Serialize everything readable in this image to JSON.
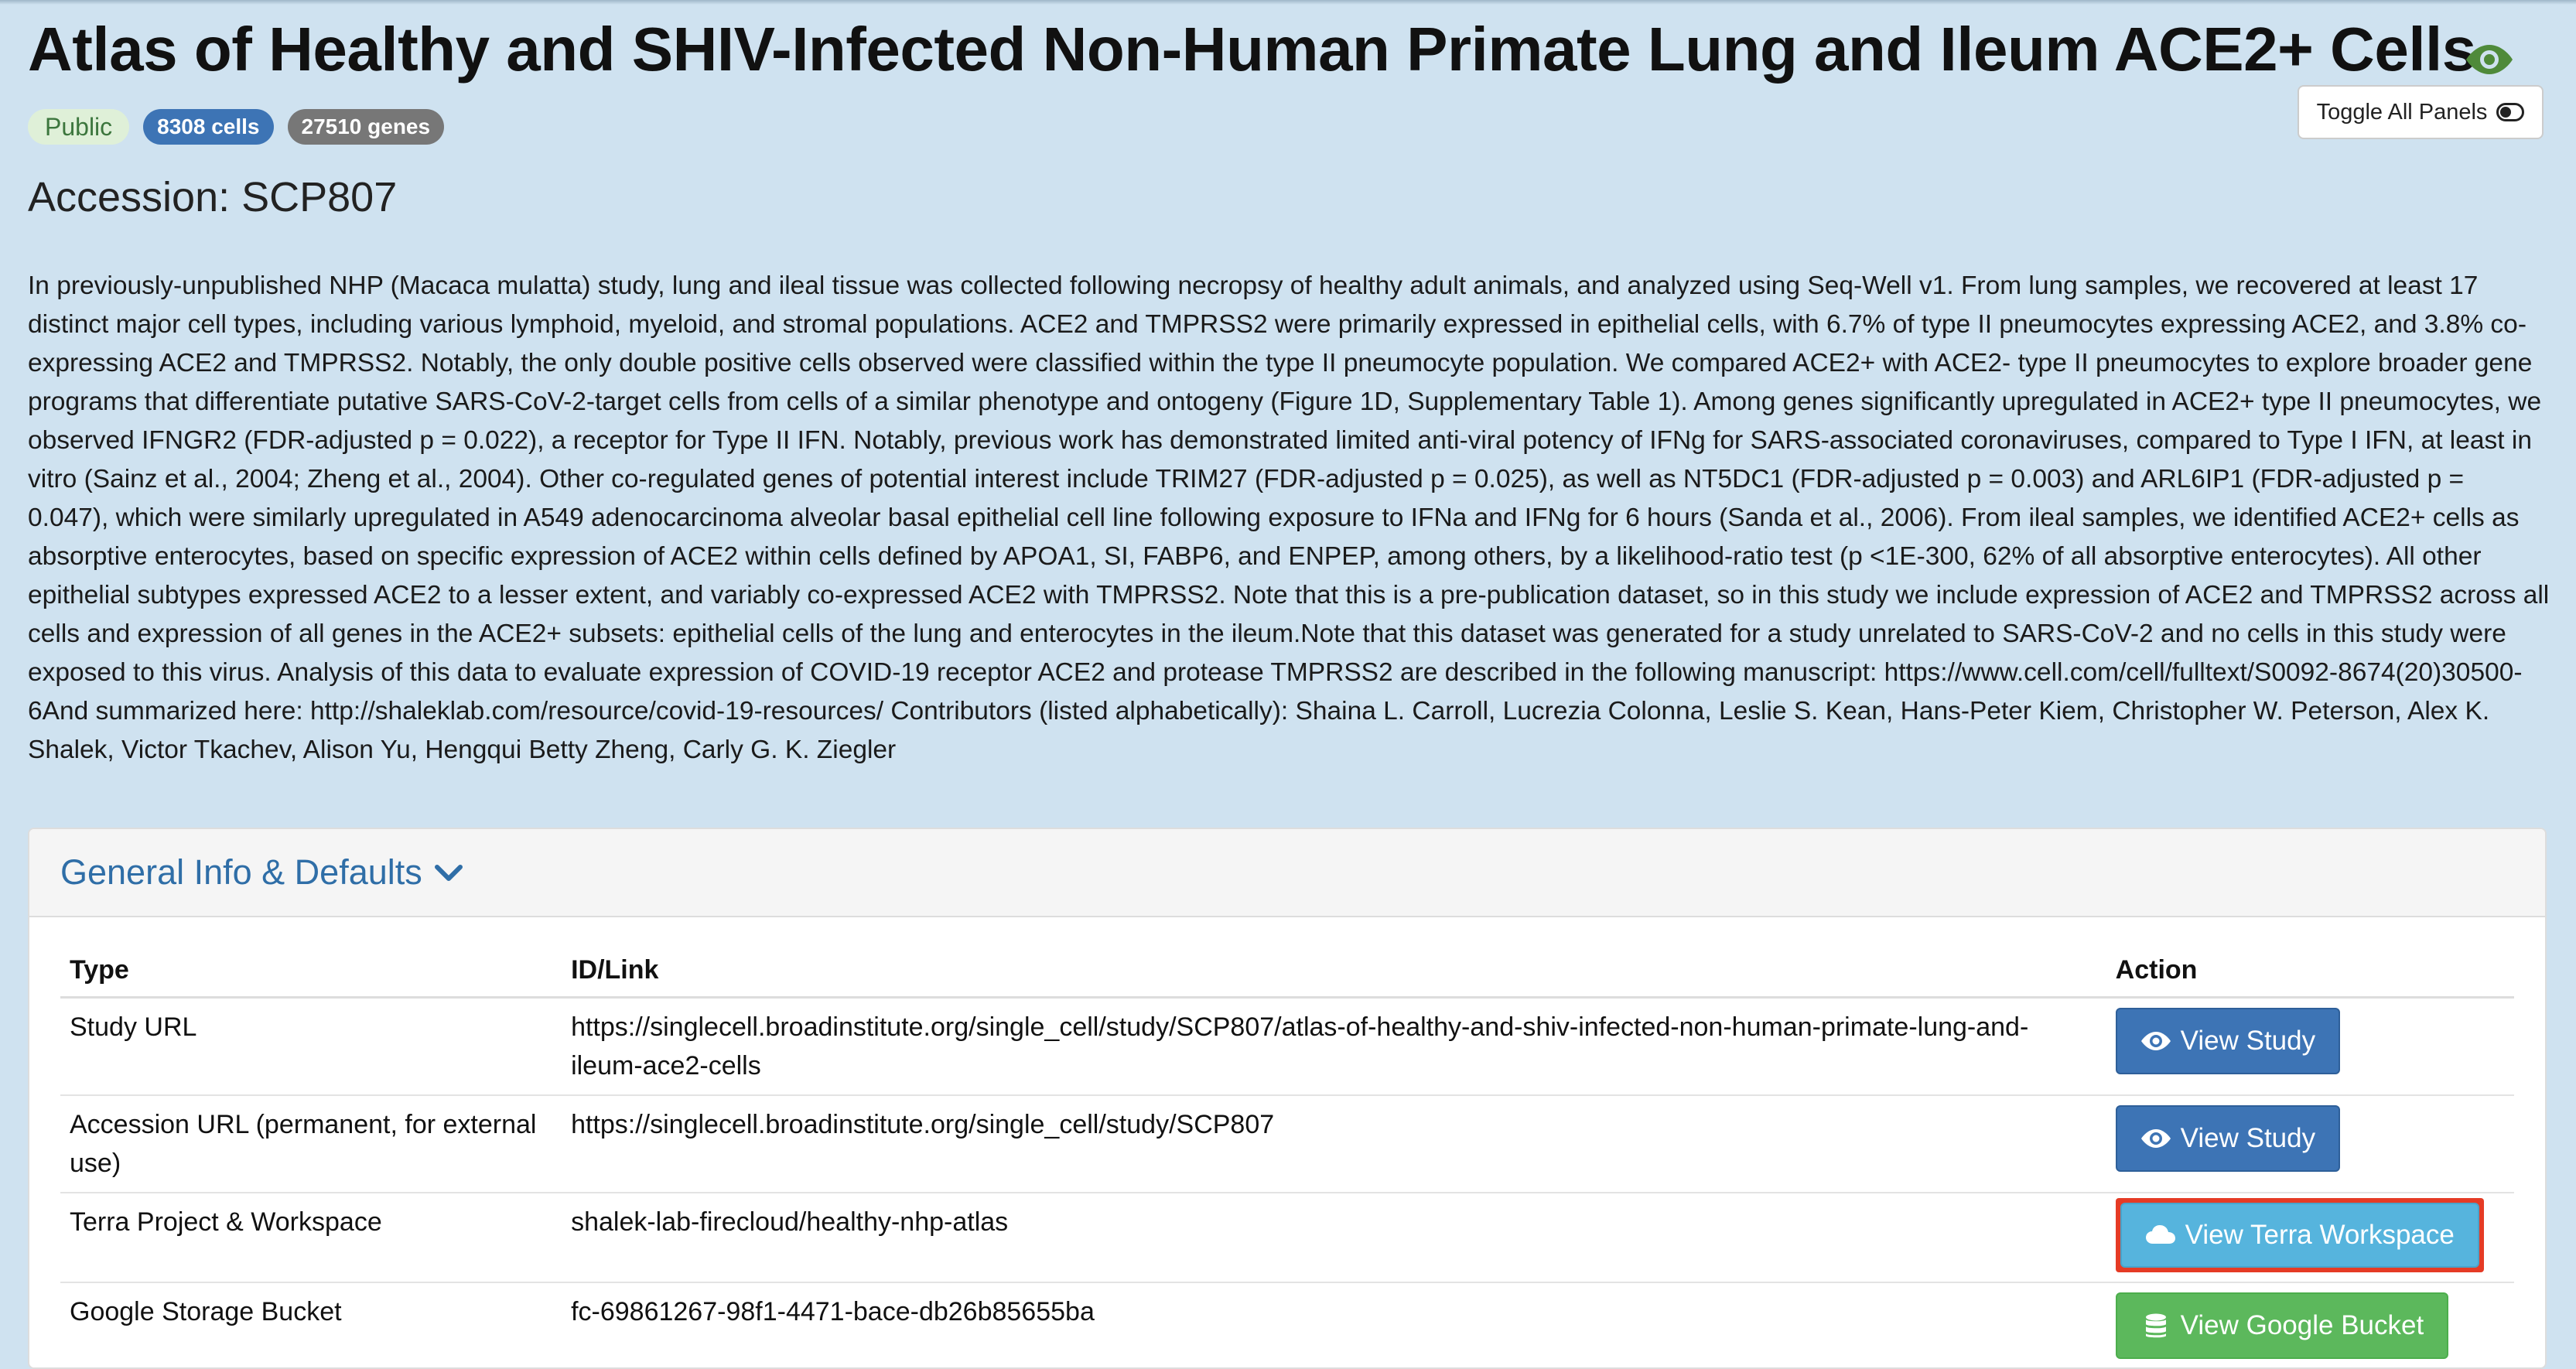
{
  "study": {
    "title": "Atlas of Healthy and SHIV-Infected Non-Human Primate Lung and Ileum ACE2+ Cells",
    "visibility_badge": "Public",
    "cells_badge": "8308 cells",
    "genes_badge": "27510 genes",
    "accession": "Accession: SCP807",
    "description": "In previously-unpublished NHP (Macaca mulatta) study, lung and ileal tissue was collected following necropsy of healthy adult animals, and analyzed using Seq-Well v1. From lung samples, we recovered at least 17 distinct major cell types, including various lymphoid, myeloid, and stromal populations. ACE2 and TMPRSS2 were primarily expressed in epithelial cells, with 6.7% of type II pneumocytes expressing ACE2, and 3.8% co-expressing ACE2 and TMPRSS2. Notably, the only double positive cells observed were classified within the type II pneumocyte population. We compared ACE2+ with ACE2- type II pneumocytes to explore broader gene programs that differentiate putative SARS-CoV-2-target cells from cells of a similar phenotype and ontogeny (Figure 1D, Supplementary Table 1). Among genes significantly upregulated in ACE2+ type II pneumocytes, we observed IFNGR2 (FDR-adjusted p = 0.022), a receptor for Type II IFN. Notably, previous work has demonstrated limited anti-viral potency of IFNg for SARS-associated coronaviruses, compared to Type I IFN, at least in vitro (Sainz et al., 2004; Zheng et al., 2004). Other co-regulated genes of potential interest include TRIM27 (FDR-adjusted p = 0.025), as well as NT5DC1 (FDR-adjusted p = 0.003) and ARL6IP1 (FDR-adjusted p = 0.047), which were similarly upregulated in A549 adenocarcinoma alveolar basal epithelial cell line following exposure to IFNa and IFNg for 6 hours (Sanda et al., 2006). From ileal samples, we identified ACE2+ cells as absorptive enterocytes, based on specific expression of ACE2 within cells defined by APOA1, SI, FABP6, and ENPEP, among others, by a likelihood-ratio test (p <1E-300, 62% of all absorptive enterocytes). All other epithelial subtypes expressed ACE2 to a lesser extent, and variably co-expressed ACE2 with TMPRSS2. Note that this is a pre-publication dataset, so in this study we include expression of ACE2 and TMPRSS2 across all cells and expression of all genes in the ACE2+ subsets: epithelial cells of the lung and enterocytes in the ileum.Note that this dataset was generated for a study unrelated to SARS-CoV-2 and no cells in this study were exposed to this virus. Analysis of this data to evaluate expression of COVID-19 receptor ACE2 and protease TMPRSS2 are described in the following manuscript: https://www.cell.com/cell/fulltext/S0092-8674(20)30500-6And summarized here: http://shaleklab.com/resource/covid-19-resources/  Contributors (listed alphabetically): Shaina L. Carroll, Lucrezia Colonna, Leslie S. Kean, Hans-Peter Kiem, Christopher W. Peterson, Alex K. Shalek, Victor Tkachev, Alison Yu, Hengqui Betty Zheng, Carly G. K. Ziegler"
  },
  "toolbar": {
    "toggle_panels_label": "Toggle All Panels"
  },
  "panel": {
    "heading": "General Info & Defaults",
    "columns": {
      "type": "Type",
      "link": "ID/Link",
      "action": "Action"
    },
    "rows": [
      {
        "type": "Study URL",
        "link": "https://singlecell.broadinstitute.org/single_cell/study/SCP807/atlas-of-healthy-and-shiv-infected-non-human-primate-lung-and-ileum-ace2-cells",
        "action": "View Study"
      },
      {
        "type": "Accession URL (permanent, for external use)",
        "link": "https://singlecell.broadinstitute.org/single_cell/study/SCP807",
        "action": "View Study"
      },
      {
        "type": "Terra Project & Workspace",
        "link": "shalek-lab-firecloud/healthy-nhp-atlas",
        "action": "View Terra Workspace"
      },
      {
        "type": "Google Storage Bucket",
        "link": "fc-69861267-98f1-4471-bace-db26b85655ba",
        "action": "View Google Bucket"
      }
    ]
  },
  "colors": {
    "page_background": "#cfe2f0",
    "primary": "#3d74b5",
    "info": "#56b4dd",
    "success": "#5cb85c",
    "highlight_outline": "#e53b25",
    "public_badge": "#dff0d8"
  },
  "icons": {
    "title": "eye-icon",
    "toggle": "toggle-switch-icon",
    "heading": "chevron-down-icon",
    "view_study": "eye-icon",
    "terra": "cloud-icon",
    "bucket": "database-icon"
  }
}
